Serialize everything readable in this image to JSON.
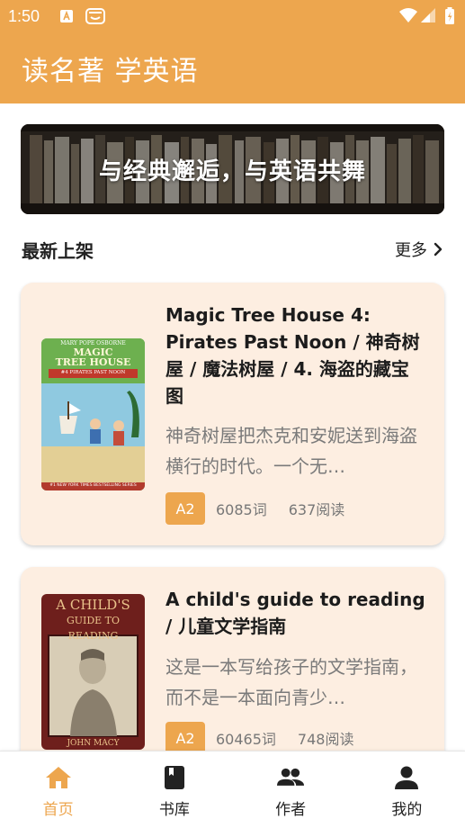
{
  "status_bar": {
    "time": "1:50"
  },
  "app": {
    "title": "读名著 学英语",
    "accent_color": "#EDA64E"
  },
  "banner": {
    "slogan": "与经典邂逅，与英语共舞"
  },
  "section": {
    "title": "最新上架",
    "more_label": "更多"
  },
  "books": [
    {
      "title": "Magic Tree House 4: Pirates Past Noon / 神奇树屋 / 魔法树屋 / 4. 海盗的藏宝图",
      "description": "神奇树屋把杰克和安妮送到海盗横行的时代。一个无…",
      "level": "A2",
      "words": "6085词",
      "reads": "637阅读",
      "cover": {
        "author": "MARY POPE OSBORNE",
        "title_line1": "MAGIC",
        "title_line2": "TREE HOUSE",
        "subtitle": "#4 PIRATES PAST NOON",
        "footer": "#1 NEW YORK TIMES BESTSELLING SERIES"
      }
    },
    {
      "title": "A child's guide to reading / 儿童文学指南",
      "description": "这是一本写给孩子的文学指南，而不是一本面向青少…",
      "level": "A2",
      "words": "60465词",
      "reads": "748阅读",
      "cover": {
        "title_line1": "A CHILD'S",
        "title_line2": "GUIDE TO READING",
        "author": "JOHN MACY"
      }
    }
  ],
  "nav": {
    "items": [
      {
        "label": "首页",
        "icon": "home-icon",
        "active": true
      },
      {
        "label": "书库",
        "icon": "book-icon",
        "active": false
      },
      {
        "label": "作者",
        "icon": "people-icon",
        "active": false
      },
      {
        "label": "我的",
        "icon": "person-icon",
        "active": false
      }
    ]
  }
}
